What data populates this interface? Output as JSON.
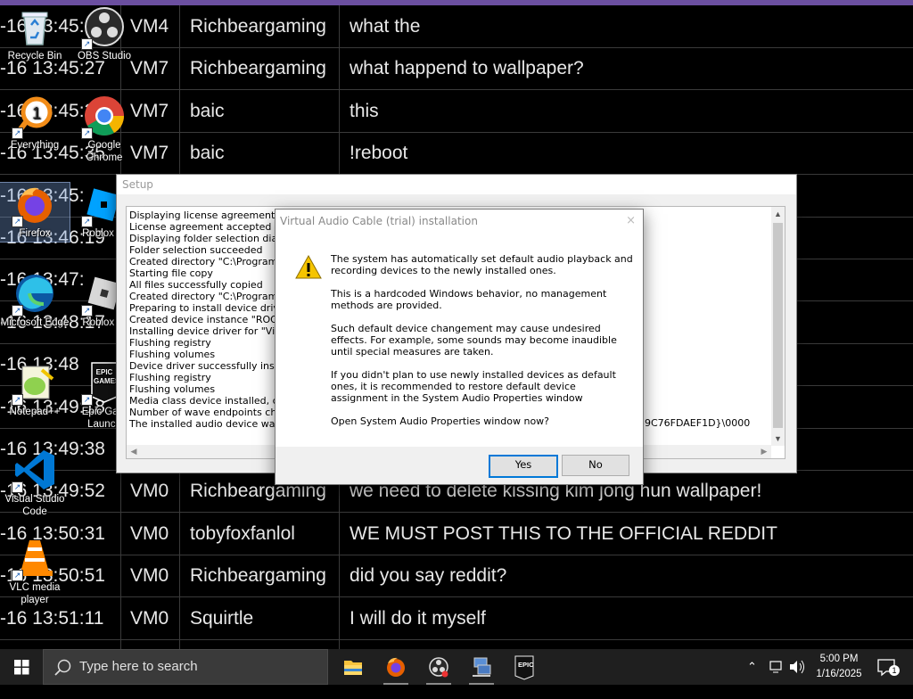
{
  "chat": {
    "rows": [
      {
        "time": "-16 13:45:04",
        "vm": "VM4",
        "user": "Richbeargaming",
        "msg": "what the"
      },
      {
        "time": "-16 13:45:27",
        "vm": "VM7",
        "user": "Richbeargaming",
        "msg": "what happend to wallpaper?"
      },
      {
        "time": "-16 13:45:31",
        "vm": "VM7",
        "user": "baic",
        "msg": "this"
      },
      {
        "time": "-16 13:45:35",
        "vm": "VM7",
        "user": "baic",
        "msg": "!reboot"
      },
      {
        "time": "-16 13:45:",
        "vm": "",
        "user": "",
        "msg": ""
      },
      {
        "time": "-16 13:46:19",
        "vm": "",
        "user": "",
        "msg": ""
      },
      {
        "time": "-16 13:47:",
        "vm": "",
        "user": "",
        "msg": ""
      },
      {
        "time": "-16 13:48:17",
        "vm": "",
        "user": "",
        "msg": ""
      },
      {
        "time": "-16 13:48",
        "vm": "",
        "user": "",
        "msg": ""
      },
      {
        "time": "-16 13:49:18",
        "vm": "",
        "user": "",
        "msg": ""
      },
      {
        "time": "-16 13:49:38",
        "vm": "",
        "user": "",
        "msg": ""
      },
      {
        "time": "-16 13:49:52",
        "vm": "VM0",
        "user": "Richbeargaming",
        "msg": "we need to delete kissing kim jong hun wallpaper!"
      },
      {
        "time": "-16 13:50:31",
        "vm": "VM0",
        "user": "tobyfoxfanlol",
        "msg": "WE MUST POST THIS TO THE OFFICIAL REDDIT"
      },
      {
        "time": "-16 13:50:51",
        "vm": "VM0",
        "user": "Richbeargaming",
        "msg": "did you say reddit?"
      },
      {
        "time": "-16 13:51:11",
        "vm": "VM0",
        "user": "Squirtle",
        "msg": "I will do it myself"
      }
    ]
  },
  "desktop": {
    "icons": [
      {
        "label": "Recycle Bin",
        "icon": "recycle-bin-icon"
      },
      {
        "label": "OBS Studio",
        "icon": "obs-studio-icon"
      },
      {
        "label": "Everything",
        "icon": "everything-search-icon"
      },
      {
        "label": "Google Chrome",
        "icon": "chrome-icon"
      },
      {
        "label": "Firefox",
        "icon": "firefox-icon"
      },
      {
        "label": "Roblox St",
        "icon": "roblox-studio-icon"
      },
      {
        "label": "Microsoft Edge",
        "icon": "edge-icon"
      },
      {
        "label": "Roblox Pl",
        "icon": "roblox-player-icon"
      },
      {
        "label": "Notepad++",
        "icon": "notepad-plus-plus-icon"
      },
      {
        "label": "Epic Gam Launch",
        "icon": "epic-games-icon"
      },
      {
        "label": "Visual Studio Code",
        "icon": "vscode-icon"
      },
      {
        "label": "VLC media player",
        "icon": "vlc-icon"
      }
    ],
    "epic_text": "EPIC GAMES"
  },
  "setup": {
    "title": "Setup",
    "log": [
      "Displaying license agreement",
      "License agreement accepted",
      "Displaying folder selection dialog",
      "Folder selection succeeded",
      "Created directory \"C:\\Program File",
      "Starting file copy",
      "All files successfully copied",
      "Created directory \"C:\\ProgramDat",
      "Preparing to install device driver fo",
      "Created device instance \"ROOT\\{8",
      "Installing device driver for \"Virtual",
      "Flushing registry",
      "Flushing volumes",
      "Device driver successfully installed",
      "Flushing registry",
      "Flushing volumes",
      "Media class device installed, check",
      "Number of wave endpoints change",
      "The installed audio device was aut"
    ],
    "log_tail": "39C76FDAEF1D}\\0000"
  },
  "dialog": {
    "title": "Virtual Audio Cable (trial) installation",
    "close": "×",
    "paragraphs": [
      "The system has automatically set default audio playback and recording devices to the newly installed ones.",
      "This is a hardcoded Windows behavior, no management methods are provided.",
      "Such default device changement may cause undesired effects. For example, some sounds may become inaudible until special measures are taken.",
      "If you didn't plan to use newly installed devices as default ones, it is recommended to restore default device assignment in the System Audio Properties window",
      "Open System Audio Properties window now?"
    ],
    "yes_label": "Yes",
    "no_label": "No"
  },
  "taskbar": {
    "search_placeholder": "Type here to search",
    "apps": [
      "file-explorer-icon",
      "firefox-icon",
      "obs-studio-icon",
      "network-app-icon",
      "epic-games-icon"
    ],
    "epic_label": "EPIC",
    "time": "5:00 PM",
    "date": "1/16/2025",
    "notification_count": "1"
  }
}
